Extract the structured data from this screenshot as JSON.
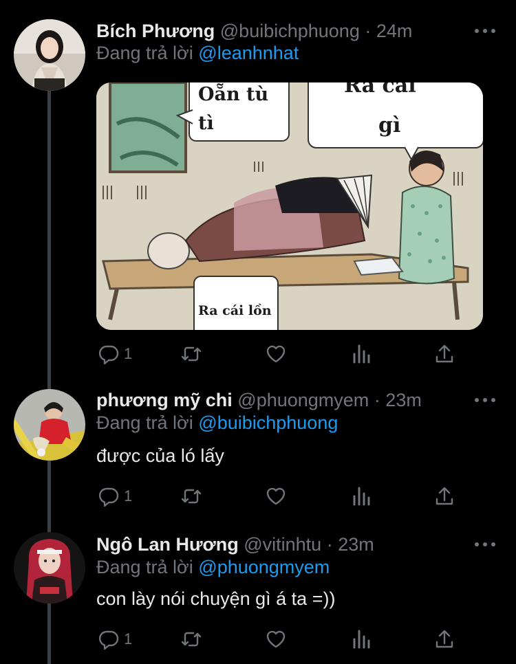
{
  "thread": {
    "tweets": [
      {
        "name": "Bích Phương",
        "handle": "@buibichphuong",
        "time": "· 24m",
        "reply_prefix": "Đang trả lời",
        "reply_to": "@leanhnhat",
        "text": "",
        "media": {
          "bubble1": [
            "Oẵn tù",
            "tì"
          ],
          "bubble2": [
            "Ra cái",
            "gì"
          ],
          "bubble3": "Ra cái lồn"
        },
        "reply_count": "1"
      },
      {
        "name": "phương mỹ chi",
        "handle": "@phuongmyem",
        "time": "· 23m",
        "reply_prefix": "Đang trả lời",
        "reply_to": "@buibichphuong",
        "text": "được của ló lấy",
        "reply_count": "1"
      },
      {
        "name": "Ngô Lan Hương",
        "handle": "@vitinhtu",
        "time": "· 23m",
        "reply_prefix": "Đang trả lời",
        "reply_to": "@phuongmyem",
        "text": "con lày nói chuyện gì á ta =))",
        "reply_count": "1"
      }
    ]
  },
  "icons": {
    "reply": "reply-icon",
    "retweet": "retweet-icon",
    "like": "like-icon",
    "views": "views-icon",
    "share": "share-icon",
    "more": "more-icon"
  },
  "colors": {
    "background": "#000000",
    "text": "#e7e9ea",
    "muted": "#71767b",
    "link": "#1d9bf0",
    "thread_line": "#3a3f44"
  }
}
